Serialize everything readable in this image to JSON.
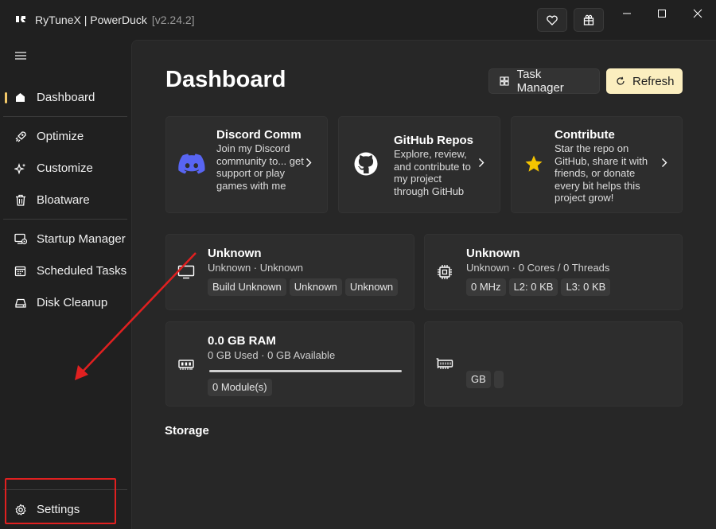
{
  "window": {
    "title": "RyTuneX | PowerDuck",
    "version": "[v2.24.2]"
  },
  "colors": {
    "accent": "#f3c969",
    "refresh_bg": "#fbeebf",
    "discord": "#5865f2",
    "annotation": "#e02020"
  },
  "sidebar": {
    "items": [
      {
        "id": "dashboard",
        "label": "Dashboard",
        "icon": "home-icon",
        "active": true
      },
      {
        "id": "optimize",
        "label": "Optimize",
        "icon": "rocket-icon"
      },
      {
        "id": "customize",
        "label": "Customize",
        "icon": "sparkle-icon"
      },
      {
        "id": "bloatware",
        "label": "Bloatware",
        "icon": "trash-icon"
      },
      {
        "id": "startup",
        "label": "Startup Manager",
        "icon": "startup-icon"
      },
      {
        "id": "scheduled",
        "label": "Scheduled Tasks",
        "icon": "calendar-icon"
      },
      {
        "id": "disk",
        "label": "Disk Cleanup",
        "icon": "disk-icon"
      }
    ],
    "settings_label": "Settings"
  },
  "main": {
    "title": "Dashboard",
    "task_manager_label": "Task Manager",
    "refresh_label": "Refresh",
    "cards": [
      {
        "title": "Discord Comm",
        "desc": "Join my Discord community to... get support or play games with me",
        "icon": "discord-icon"
      },
      {
        "title": "GitHub Repos",
        "desc": "Explore, review, and contribute to my project through GitHub",
        "icon": "github-icon"
      },
      {
        "title": "Contribute",
        "desc": "Star the repo on GitHub, share it with friends, or donate every bit helps this project grow!",
        "icon": "star-icon"
      }
    ],
    "os": {
      "title": "Unknown",
      "subtitle": "Unknown · Unknown",
      "chips": [
        "Build Unknown",
        "Unknown",
        "Unknown"
      ]
    },
    "cpu": {
      "title": "Unknown",
      "subtitle": "Unknown · 0 Cores / 0 Threads",
      "chips": [
        "0 MHz",
        "L2: 0 KB",
        "L3: 0 KB"
      ]
    },
    "ram": {
      "title": "0.0 GB RAM",
      "subtitle": "0 GB Used · 0 GB Available",
      "usage_fraction": 0,
      "chips": [
        "0 Module(s)"
      ]
    },
    "gpu": {
      "chips": [
        "GB"
      ]
    },
    "storage_title": "Storage"
  }
}
